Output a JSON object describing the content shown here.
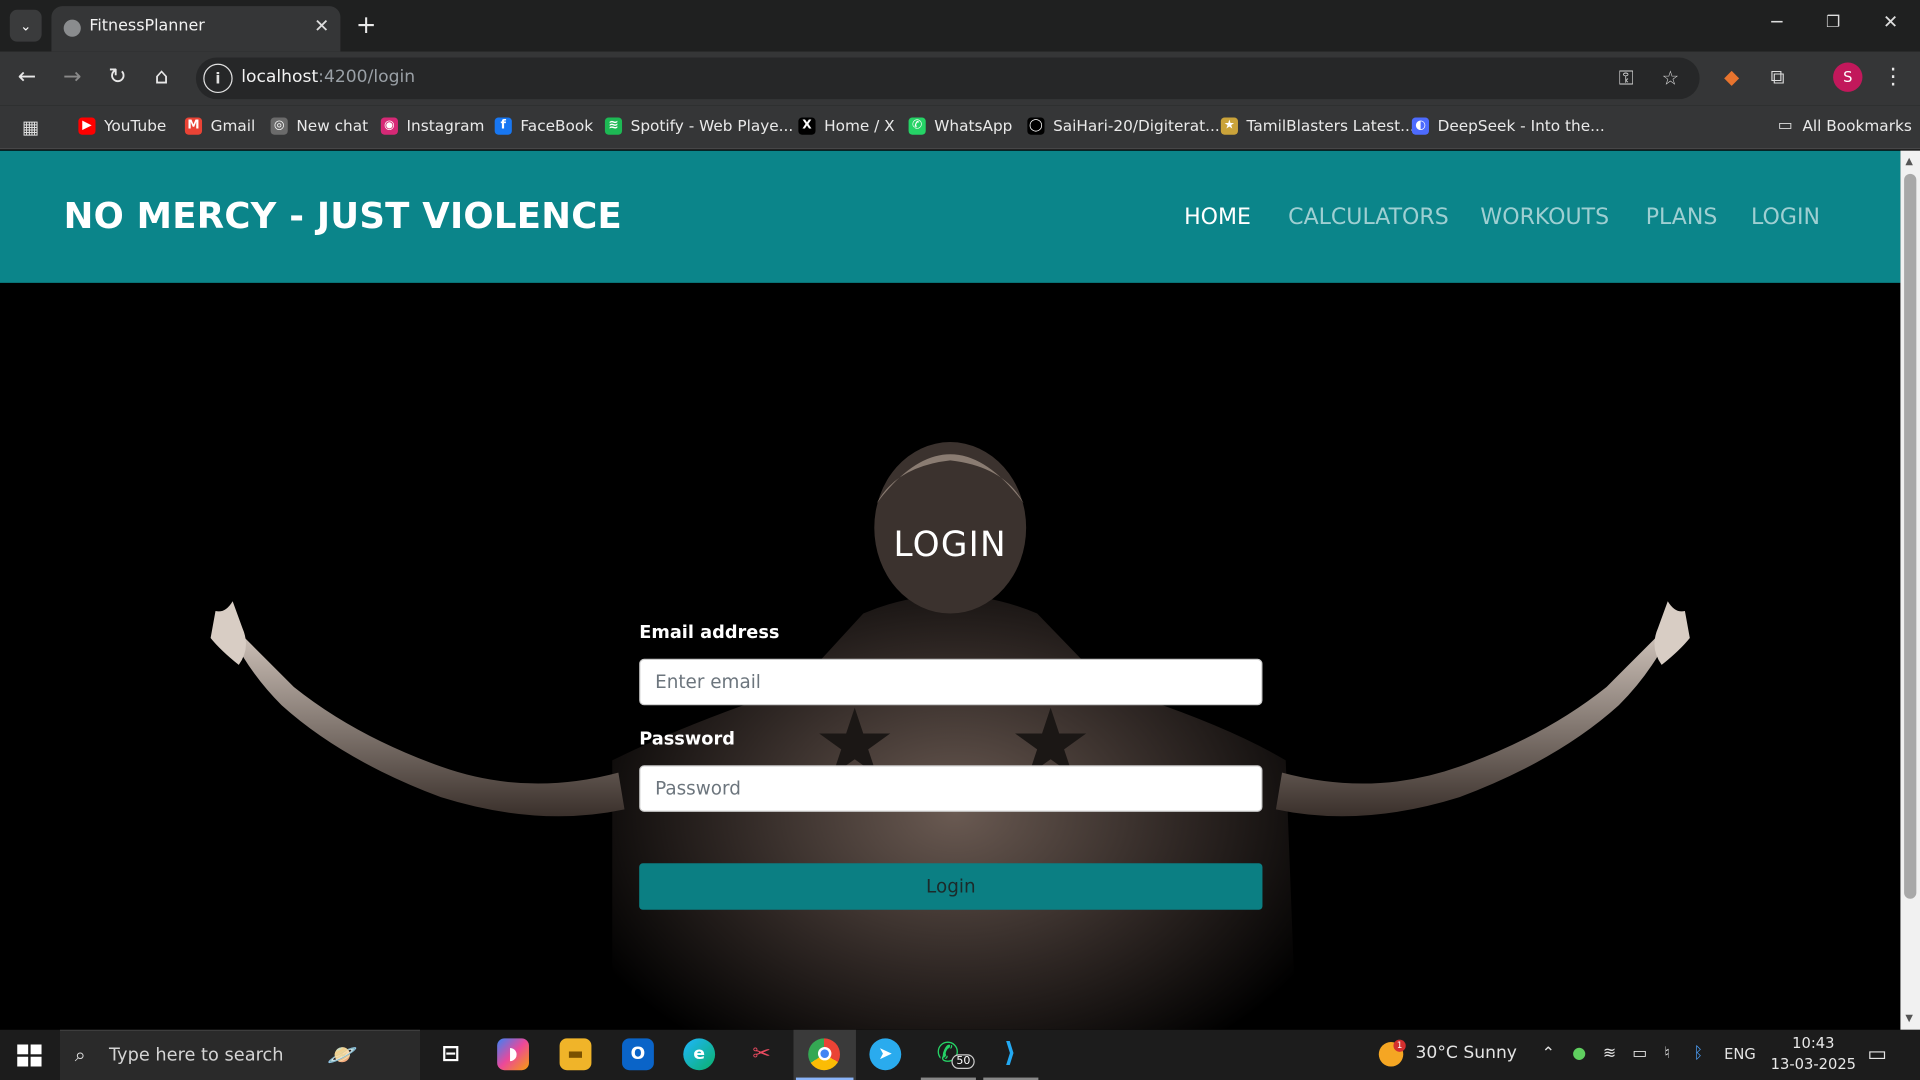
{
  "browser": {
    "tab_title": "FitnessPlanner",
    "url_host": "localhost",
    "url_rest": ":4200/login",
    "bookmarks": [
      {
        "label": "YouTube",
        "color": "#ff0000",
        "glyph": "▶"
      },
      {
        "label": "Gmail",
        "color": "#ea4335",
        "glyph": "M"
      },
      {
        "label": "New chat",
        "color": "#6b6b6b",
        "glyph": "◎"
      },
      {
        "label": "Instagram",
        "color": "#d62976",
        "glyph": "◉"
      },
      {
        "label": "FaceBook",
        "color": "#1877f2",
        "glyph": "f"
      },
      {
        "label": "Spotify - Web Playe...",
        "color": "#1db954",
        "glyph": "≋"
      },
      {
        "label": "Home / X",
        "color": "#000000",
        "glyph": "X"
      },
      {
        "label": "WhatsApp",
        "color": "#25d366",
        "glyph": "✆"
      },
      {
        "label": "SaiHari-20/Digiterat...",
        "color": "#000000",
        "glyph": "◯"
      },
      {
        "label": "TamilBlasters Latest...",
        "color": "#caa33a",
        "glyph": "★"
      },
      {
        "label": "DeepSeek - Into the...",
        "color": "#4d6bfe",
        "glyph": "◐"
      }
    ],
    "all_bookmarks": "All Bookmarks",
    "profile_initial": "S"
  },
  "site": {
    "brand": "NO MERCY - JUST VIOLENCE",
    "nav": [
      "HOME",
      "CALCULATORS",
      "WORKOUTS",
      "PLANS",
      "LOGIN"
    ],
    "accent": "#0b858a"
  },
  "form": {
    "title": "LOGIN",
    "email_label": "Email address",
    "email_placeholder": "Enter email",
    "password_label": "Password",
    "password_placeholder": "Password",
    "submit_label": "Login"
  },
  "taskbar": {
    "search_placeholder": "Type here to search",
    "whatsapp_badge": "50",
    "weather": "30°C  Sunny",
    "weather_badge": "1",
    "language": "ENG",
    "time": "10:43",
    "date": "13-03-2025"
  }
}
